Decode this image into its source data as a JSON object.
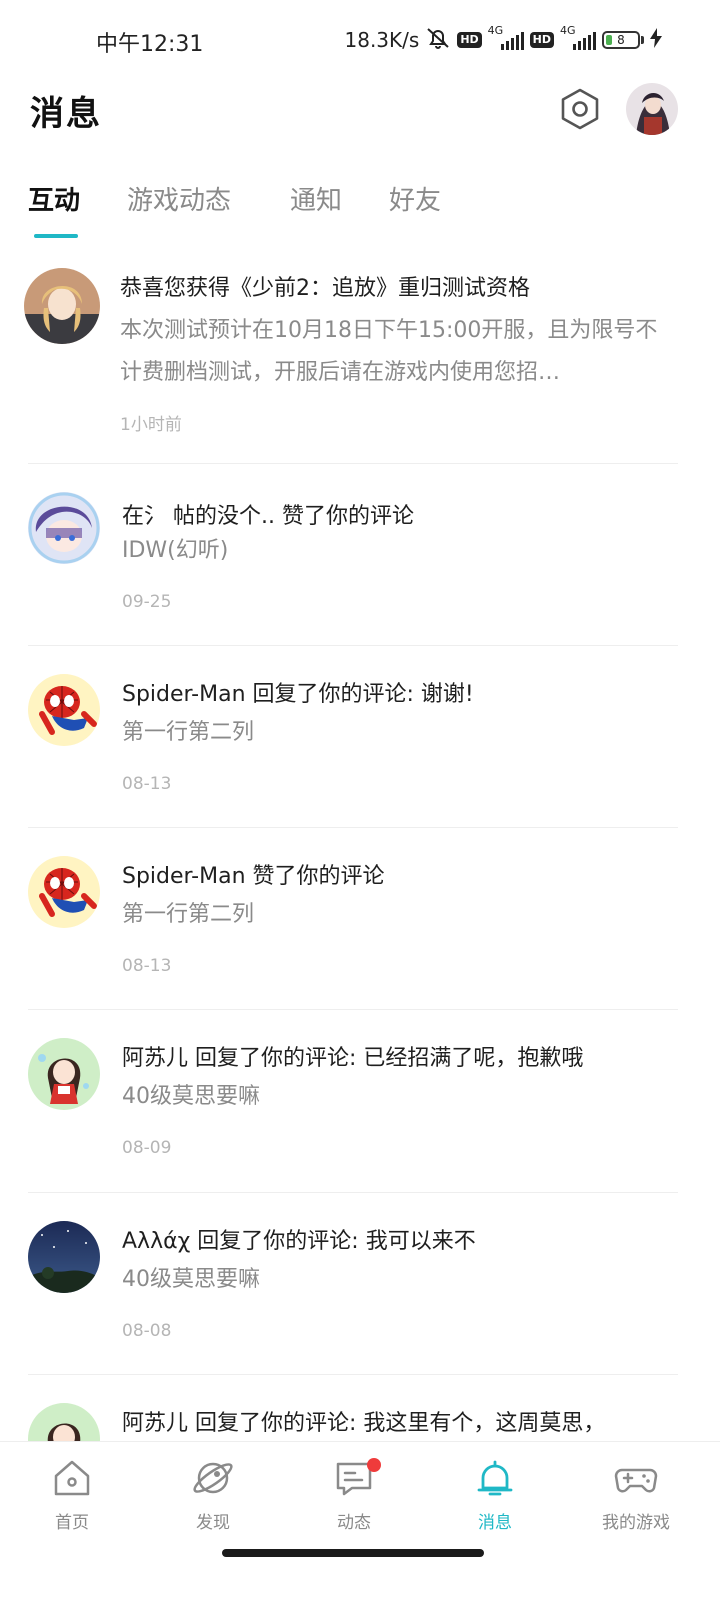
{
  "status_bar": {
    "time": "中午12:31",
    "speed": "18.3K/s",
    "battery": "8",
    "signal1": "4G",
    "signal2": "4G",
    "hd1": "HD",
    "hd2": "HD"
  },
  "header": {
    "title": "消息"
  },
  "tabs": [
    {
      "label": "互动",
      "active": true
    },
    {
      "label": "游戏动态",
      "active": false
    },
    {
      "label": "通知",
      "active": false
    },
    {
      "label": "好友",
      "active": false
    }
  ],
  "messages": [
    {
      "title": "恭喜您获得《少前2：追放》重归测试资格",
      "body": "本次测试预计在10月18日下午15:00开服，且为限号不计费删档测试，开服后请在游戏内使用您招…",
      "time": "1小时前",
      "avatar": "anime-blonde"
    },
    {
      "title": "在氵 帖的没个.. 赞了你的评论",
      "body": "IDW(幻听)",
      "time": "09-25",
      "avatar": "anime-purple"
    },
    {
      "title": "Spider-Man 回复了你的评论: 谢谢!",
      "body": "第一行第二列",
      "time": "08-13",
      "avatar": "spiderman"
    },
    {
      "title": "Spider-Man 赞了你的评论",
      "body": "第一行第二列",
      "time": "08-13",
      "avatar": "spiderman"
    },
    {
      "title": "阿苏儿 回复了你的评论: 已经招满了呢，抱歉哦",
      "body": "40级莫思要嘛",
      "time": "08-09",
      "avatar": "chibi-girl"
    },
    {
      "title": "Αλλάχ 回复了你的评论: 我可以来不",
      "body": "40级莫思要嘛",
      "time": "08-08",
      "avatar": "night-sky"
    },
    {
      "title": "阿苏儿 回复了你的评论: 我这里有个，这周莫思，",
      "body": "",
      "time": "",
      "avatar": "chibi-girl"
    }
  ],
  "bottom_nav": [
    {
      "label": "首页",
      "icon": "home-icon",
      "active": false
    },
    {
      "label": "发现",
      "icon": "discover-icon",
      "active": false
    },
    {
      "label": "动态",
      "icon": "feed-icon",
      "active": false,
      "badge": true
    },
    {
      "label": "消息",
      "icon": "bell-icon",
      "active": true
    },
    {
      "label": "我的游戏",
      "icon": "gamepad-icon",
      "active": false
    }
  ],
  "colors": {
    "accent": "#1fb8c6",
    "badge": "#ef3b3b",
    "text": "#1f1f1f",
    "muted": "#8a8a8a",
    "light": "#b5b5b5"
  }
}
